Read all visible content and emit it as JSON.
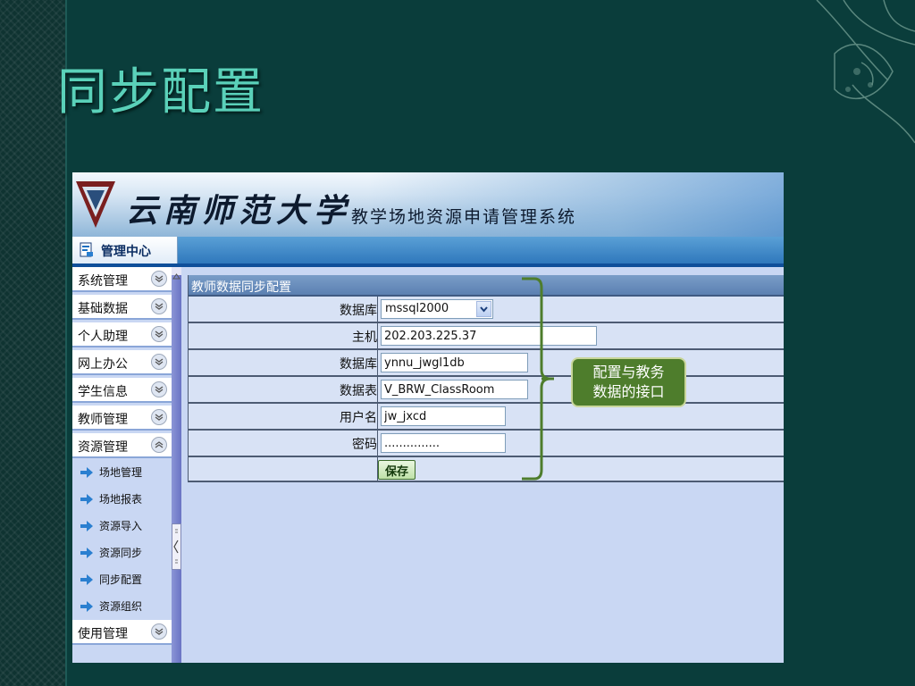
{
  "slide": {
    "title": "同步配置"
  },
  "app": {
    "university_name": "云南师范大学",
    "system_name": "教学场地资源申请管理系统",
    "tab_label": "管理中心"
  },
  "sidebar": {
    "items": [
      {
        "label": "系统管理",
        "expanded": false
      },
      {
        "label": "基础数据",
        "expanded": false
      },
      {
        "label": "个人助理",
        "expanded": false
      },
      {
        "label": "网上办公",
        "expanded": false
      },
      {
        "label": "学生信息",
        "expanded": false
      },
      {
        "label": "教师管理",
        "expanded": false
      },
      {
        "label": "资源管理",
        "expanded": true
      },
      {
        "label": "使用管理",
        "expanded": false
      }
    ],
    "sub_items": [
      "场地管理",
      "场地报表",
      "资源导入",
      "资源同步",
      "同步配置",
      "资源组织"
    ]
  },
  "form": {
    "title": "教师数据同步配置",
    "db_type": {
      "label": "数据库",
      "value": "mssql2000"
    },
    "host": {
      "label": "主机",
      "value": "202.203.225.37"
    },
    "database": {
      "label": "数据库",
      "value": "ynnu_jwgl1db"
    },
    "table": {
      "label": "数据表",
      "value": "V_BRW_ClassRoom"
    },
    "username": {
      "label": "用户名",
      "value": "jw_jxcd"
    },
    "password": {
      "label": "密码",
      "value": "..............."
    },
    "save_label": "保存"
  },
  "annotation": {
    "line1": "配置与教务",
    "line2": "数据的接口"
  },
  "colors": {
    "slide_bg": "#0a3d3b",
    "title": "#5ad1b9",
    "header_bar": "#5b80b1",
    "row_bg": "#d8e2f5",
    "callout_bg": "#4e7d2c",
    "brace": "#4e7d2c"
  }
}
